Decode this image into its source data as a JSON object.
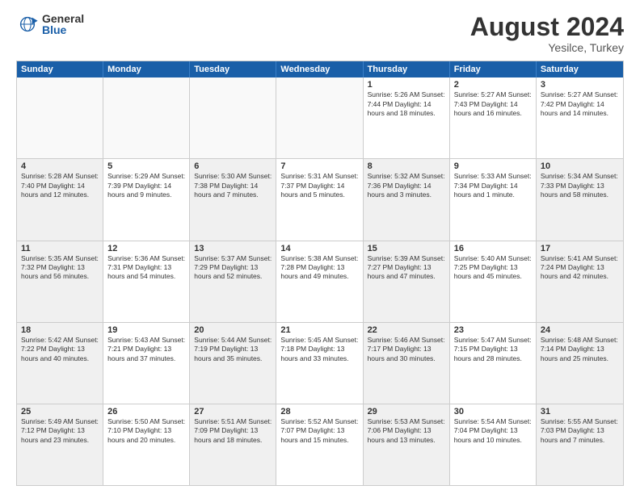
{
  "logo": {
    "general": "General",
    "blue": "Blue"
  },
  "title": "August 2024",
  "location": "Yesilce, Turkey",
  "days": [
    "Sunday",
    "Monday",
    "Tuesday",
    "Wednesday",
    "Thursday",
    "Friday",
    "Saturday"
  ],
  "weeks": [
    [
      {
        "day": "",
        "info": "",
        "empty": true
      },
      {
        "day": "",
        "info": "",
        "empty": true
      },
      {
        "day": "",
        "info": "",
        "empty": true
      },
      {
        "day": "",
        "info": "",
        "empty": true
      },
      {
        "day": "1",
        "info": "Sunrise: 5:26 AM\nSunset: 7:44 PM\nDaylight: 14 hours\nand 18 minutes."
      },
      {
        "day": "2",
        "info": "Sunrise: 5:27 AM\nSunset: 7:43 PM\nDaylight: 14 hours\nand 16 minutes."
      },
      {
        "day": "3",
        "info": "Sunrise: 5:27 AM\nSunset: 7:42 PM\nDaylight: 14 hours\nand 14 minutes."
      }
    ],
    [
      {
        "day": "4",
        "info": "Sunrise: 5:28 AM\nSunset: 7:40 PM\nDaylight: 14 hours\nand 12 minutes.",
        "shaded": true
      },
      {
        "day": "5",
        "info": "Sunrise: 5:29 AM\nSunset: 7:39 PM\nDaylight: 14 hours\nand 9 minutes."
      },
      {
        "day": "6",
        "info": "Sunrise: 5:30 AM\nSunset: 7:38 PM\nDaylight: 14 hours\nand 7 minutes.",
        "shaded": true
      },
      {
        "day": "7",
        "info": "Sunrise: 5:31 AM\nSunset: 7:37 PM\nDaylight: 14 hours\nand 5 minutes."
      },
      {
        "day": "8",
        "info": "Sunrise: 5:32 AM\nSunset: 7:36 PM\nDaylight: 14 hours\nand 3 minutes.",
        "shaded": true
      },
      {
        "day": "9",
        "info": "Sunrise: 5:33 AM\nSunset: 7:34 PM\nDaylight: 14 hours\nand 1 minute."
      },
      {
        "day": "10",
        "info": "Sunrise: 5:34 AM\nSunset: 7:33 PM\nDaylight: 13 hours\nand 58 minutes.",
        "shaded": true
      }
    ],
    [
      {
        "day": "11",
        "info": "Sunrise: 5:35 AM\nSunset: 7:32 PM\nDaylight: 13 hours\nand 56 minutes.",
        "shaded": true
      },
      {
        "day": "12",
        "info": "Sunrise: 5:36 AM\nSunset: 7:31 PM\nDaylight: 13 hours\nand 54 minutes."
      },
      {
        "day": "13",
        "info": "Sunrise: 5:37 AM\nSunset: 7:29 PM\nDaylight: 13 hours\nand 52 minutes.",
        "shaded": true
      },
      {
        "day": "14",
        "info": "Sunrise: 5:38 AM\nSunset: 7:28 PM\nDaylight: 13 hours\nand 49 minutes."
      },
      {
        "day": "15",
        "info": "Sunrise: 5:39 AM\nSunset: 7:27 PM\nDaylight: 13 hours\nand 47 minutes.",
        "shaded": true
      },
      {
        "day": "16",
        "info": "Sunrise: 5:40 AM\nSunset: 7:25 PM\nDaylight: 13 hours\nand 45 minutes."
      },
      {
        "day": "17",
        "info": "Sunrise: 5:41 AM\nSunset: 7:24 PM\nDaylight: 13 hours\nand 42 minutes.",
        "shaded": true
      }
    ],
    [
      {
        "day": "18",
        "info": "Sunrise: 5:42 AM\nSunset: 7:22 PM\nDaylight: 13 hours\nand 40 minutes.",
        "shaded": true
      },
      {
        "day": "19",
        "info": "Sunrise: 5:43 AM\nSunset: 7:21 PM\nDaylight: 13 hours\nand 37 minutes."
      },
      {
        "day": "20",
        "info": "Sunrise: 5:44 AM\nSunset: 7:19 PM\nDaylight: 13 hours\nand 35 minutes.",
        "shaded": true
      },
      {
        "day": "21",
        "info": "Sunrise: 5:45 AM\nSunset: 7:18 PM\nDaylight: 13 hours\nand 33 minutes."
      },
      {
        "day": "22",
        "info": "Sunrise: 5:46 AM\nSunset: 7:17 PM\nDaylight: 13 hours\nand 30 minutes.",
        "shaded": true
      },
      {
        "day": "23",
        "info": "Sunrise: 5:47 AM\nSunset: 7:15 PM\nDaylight: 13 hours\nand 28 minutes."
      },
      {
        "day": "24",
        "info": "Sunrise: 5:48 AM\nSunset: 7:14 PM\nDaylight: 13 hours\nand 25 minutes.",
        "shaded": true
      }
    ],
    [
      {
        "day": "25",
        "info": "Sunrise: 5:49 AM\nSunset: 7:12 PM\nDaylight: 13 hours\nand 23 minutes.",
        "shaded": true
      },
      {
        "day": "26",
        "info": "Sunrise: 5:50 AM\nSunset: 7:10 PM\nDaylight: 13 hours\nand 20 minutes."
      },
      {
        "day": "27",
        "info": "Sunrise: 5:51 AM\nSunset: 7:09 PM\nDaylight: 13 hours\nand 18 minutes.",
        "shaded": true
      },
      {
        "day": "28",
        "info": "Sunrise: 5:52 AM\nSunset: 7:07 PM\nDaylight: 13 hours\nand 15 minutes."
      },
      {
        "day": "29",
        "info": "Sunrise: 5:53 AM\nSunset: 7:06 PM\nDaylight: 13 hours\nand 13 minutes.",
        "shaded": true
      },
      {
        "day": "30",
        "info": "Sunrise: 5:54 AM\nSunset: 7:04 PM\nDaylight: 13 hours\nand 10 minutes."
      },
      {
        "day": "31",
        "info": "Sunrise: 5:55 AM\nSunset: 7:03 PM\nDaylight: 13 hours\nand 7 minutes.",
        "shaded": true
      }
    ]
  ]
}
